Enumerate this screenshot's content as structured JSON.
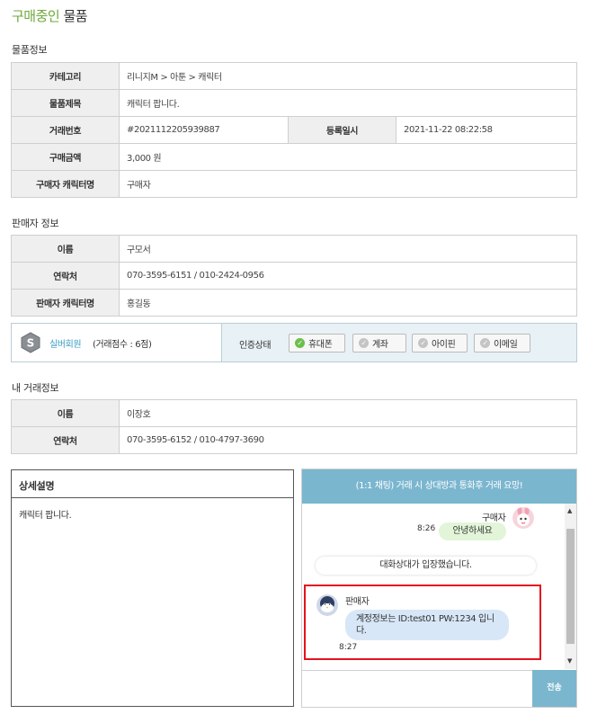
{
  "page": {
    "title_highlight": "구매중인",
    "title_rest": "물품"
  },
  "item_info": {
    "section_title": "물품정보",
    "category_label": "카테고리",
    "category_value": "리니지M > 아툰 > 캐릭터",
    "item_title_label": "물품제목",
    "item_title_value": "캐릭터 팝니다.",
    "trade_no_label": "거래번호",
    "trade_no_value": "#2021112205939887",
    "reg_date_label": "등록일시",
    "reg_date_value": "2021-11-22 08:22:58",
    "price_label": "구매금액",
    "price_value": "3,000 원",
    "buyer_char_label": "구매자 캐릭터명",
    "buyer_char_value": "구매자"
  },
  "seller_info": {
    "section_title": "판매자 정보",
    "name_label": "이름",
    "name_value": "구모서",
    "contact_label": "연락처",
    "contact_value": "070-3595-6151 / 010-2424-0956",
    "char_label": "판매자 캐릭터명",
    "char_value": "홍길동"
  },
  "seller_grade": {
    "badge_letter": "S",
    "grade": "실버회원",
    "score": "(거래점수 : 6점)",
    "cert_label": "인증상태",
    "certs": [
      {
        "label": "휴대폰",
        "verified": true
      },
      {
        "label": "계좌",
        "verified": false
      },
      {
        "label": "아이핀",
        "verified": false
      },
      {
        "label": "이메일",
        "verified": false
      }
    ],
    "check_mark": "✓",
    "colors": {
      "verified": "#6cbf4a",
      "unverified": "#c4c4c4"
    }
  },
  "my_info": {
    "section_title": "내 거래정보",
    "name_label": "이름",
    "name_value": "이장호",
    "contact_label": "연락처",
    "contact_value": "070-3595-6152 / 010-4797-3690"
  },
  "description": {
    "title": "상세설명",
    "body": "캐릭터 팝니다."
  },
  "chat": {
    "header": "(1:1 채팅) 거래 시 상대방과 통화후 거래 요망!",
    "messages": [
      {
        "sender": "구매자",
        "time": "8:26",
        "text": "안녕하세요",
        "side": "right"
      },
      {
        "system": "대화상대가 입장했습니다."
      },
      {
        "sender": "판매자",
        "time": "8:27",
        "text": "계정정보는 ID:test01 PW:1234 입니다.",
        "side": "left"
      }
    ],
    "input_value": "",
    "send_label": "전송",
    "colors": {
      "accent": "#7bb6cf",
      "buyer_bubble": "#e2f5d8",
      "seller_bubble": "#d7e7f7",
      "highlight_box": "#e3141c"
    }
  }
}
